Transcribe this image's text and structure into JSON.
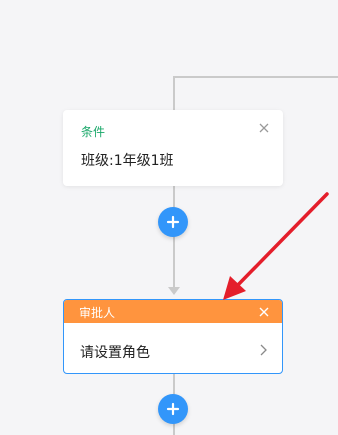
{
  "condition_card": {
    "title": "条件",
    "body": "班级:1年级1班",
    "title_color": "#1aa86a"
  },
  "approver_card": {
    "title": "审批人",
    "body": "请设置角色",
    "header_color": "#ff943e",
    "border_color": "#3296fa"
  },
  "add_buttons": {
    "color": "#3296fa",
    "icon": "plus-icon"
  },
  "annotation": {
    "color": "#e41e2b",
    "icon": "red-arrow"
  }
}
